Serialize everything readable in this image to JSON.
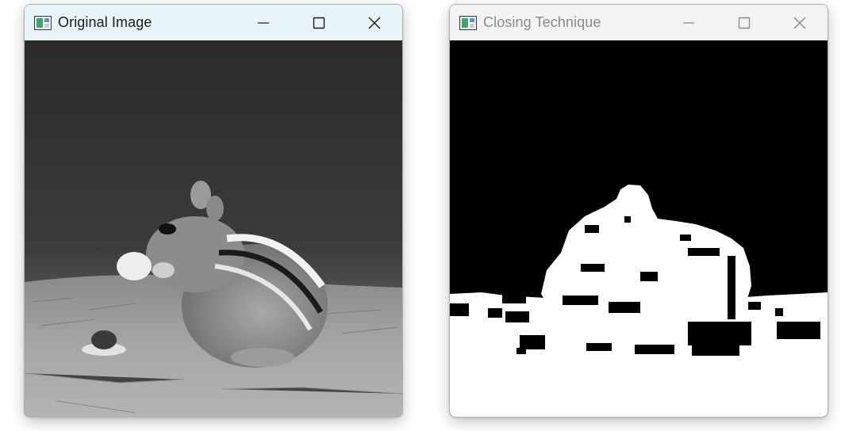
{
  "windows": [
    {
      "title": "Original Image",
      "controls": [
        "minimize-icon",
        "maximize-icon",
        "close-icon"
      ],
      "image": "grayscale photo of a chipmunk eating, sitting on a paved surface"
    },
    {
      "title": "Closing Technique",
      "controls": [
        "minimize-icon",
        "maximize-icon",
        "close-icon"
      ],
      "image": "binary black and white morphological closing result"
    }
  ],
  "colors": {
    "active_titlebar": "#e9f4f8",
    "inactive_titlebar": "#f3f3f3",
    "active_title_text": "#1b1b1b",
    "inactive_title_text": "#8a8a8a"
  }
}
